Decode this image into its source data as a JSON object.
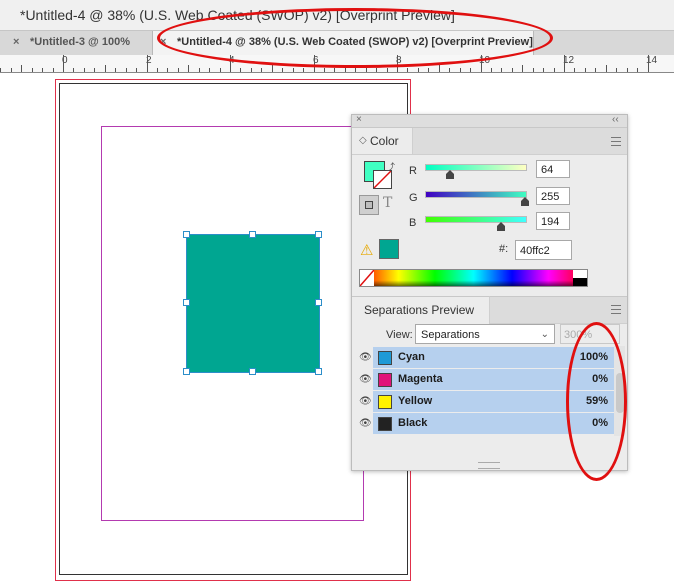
{
  "window": {
    "title": "*Untitled-4 @ 38% (U.S. Web Coated (SWOP) v2) [Overprint Preview]"
  },
  "tabs": [
    {
      "close": "×",
      "label": "*Untitled-3 @ 100%"
    },
    {
      "close": "×",
      "label": "*Untitled-4 @ 38% (U.S. Web Coated (SWOP) v2) [Overprint Preview]"
    }
  ],
  "ruler": {
    "labels": [
      "0",
      "2",
      "4",
      "6",
      "8",
      "10",
      "12",
      "14"
    ]
  },
  "color_panel": {
    "close": "×",
    "collapse": "‹‹",
    "tab_label": "Color",
    "tab_arrow": "◇",
    "swap_icon": "⤴",
    "text_mode": "T",
    "channels": [
      {
        "label": "R",
        "value": "64",
        "level": 64,
        "gradient": "linear-gradient(to right,#00ffc2,#ffffc2)"
      },
      {
        "label": "G",
        "value": "255",
        "level": 255,
        "gradient": "linear-gradient(to right,#4000c2,#40ffc2)"
      },
      {
        "label": "B",
        "value": "194",
        "level": 194,
        "gradient": "linear-gradient(to right,#40ff00,#40ffff)"
      }
    ],
    "warning_icon": "⚠",
    "hex_label": "#:",
    "hex_value": "40ffc2",
    "fill_color": "#40ffc2",
    "out_of_gamut_color": "#00a691"
  },
  "separations": {
    "tab_label": "Separations Preview",
    "view_label": "View:",
    "view_value": "Separations",
    "view_chevron": "⌄",
    "zoom_value": "300%",
    "eye_icon": "👁",
    "inks": [
      {
        "name": "Cyan",
        "percent": "100%",
        "color": "#1f9ad6"
      },
      {
        "name": "Magenta",
        "percent": "0%",
        "color": "#e0147a"
      },
      {
        "name": "Yellow",
        "percent": "59%",
        "color": "#fff200"
      },
      {
        "name": "Black",
        "percent": "0%",
        "color": "#222222"
      }
    ]
  },
  "document": {
    "selected_object_color": "#00a691"
  }
}
